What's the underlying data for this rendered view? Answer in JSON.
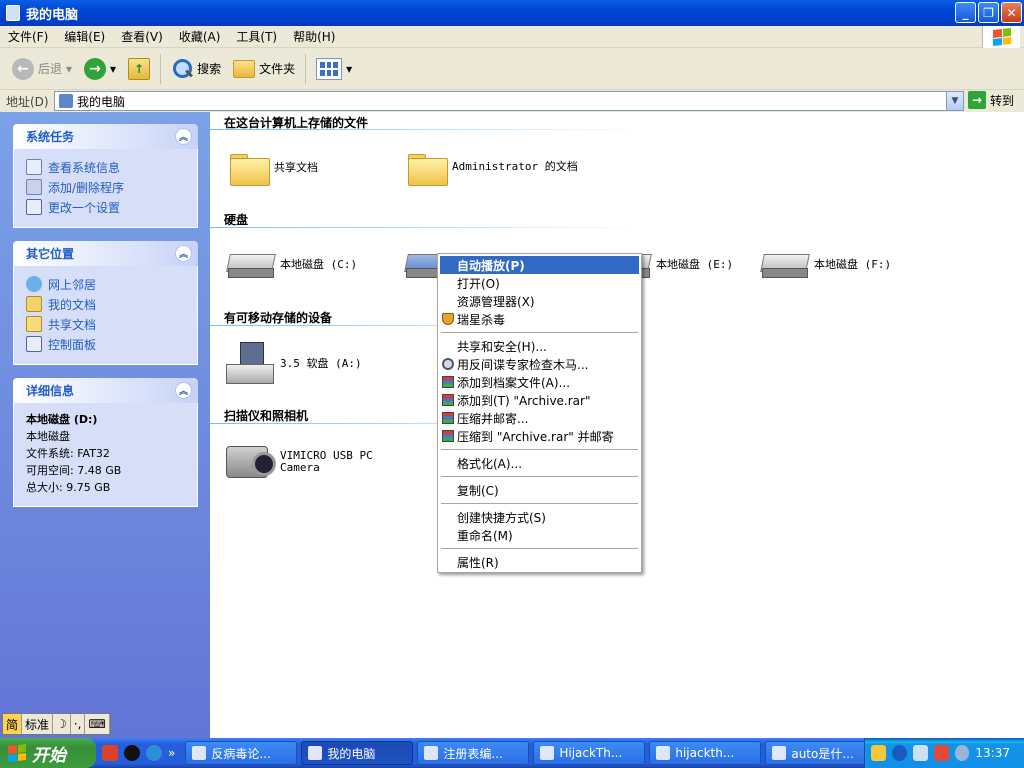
{
  "window": {
    "title": "我的电脑"
  },
  "menubar": [
    "文件(F)",
    "编辑(E)",
    "查看(V)",
    "收藏(A)",
    "工具(T)",
    "帮助(H)"
  ],
  "toolbar": {
    "back": "后退",
    "search": "搜索",
    "folders": "文件夹"
  },
  "address": {
    "label": "地址(D)",
    "value": "我的电脑",
    "go": "转到"
  },
  "sidebar": {
    "system_tasks": {
      "title": "系统任务",
      "items": [
        "查看系统信息",
        "添加/删除程序",
        "更改一个设置"
      ]
    },
    "other_places": {
      "title": "其它位置",
      "items": [
        "网上邻居",
        "我的文档",
        "共享文档",
        "控制面板"
      ]
    },
    "details": {
      "title": "详细信息",
      "name": "本地磁盘  (D:)",
      "type": "本地磁盘",
      "fs": "文件系统: FAT32",
      "free": "可用空间: 7.48 GB",
      "total": "总大小: 9.75 GB"
    }
  },
  "groups": {
    "files": {
      "title": "在这台计算机上存储的文件",
      "items": [
        "共享文档",
        "Administrator 的文档"
      ]
    },
    "hdd": {
      "title": "硬盘",
      "items": [
        "本地磁盘 (C:)",
        "本地磁盘 (E:)",
        "本地磁盘 (F:)"
      ]
    },
    "removable": {
      "title": "有可移动存储的设备",
      "items": [
        "3.5 软盘 (A:)"
      ]
    },
    "scanners": {
      "title": "扫描仪和照相机",
      "items": [
        "VIMICRO USB PC Camera"
      ]
    }
  },
  "context_menu": {
    "items": [
      "自动播放(P)",
      "打开(O)",
      "资源管理器(X)",
      "瑞星杀毒",
      "共享和安全(H)...",
      "用反间谍专家检查木马...",
      "添加到档案文件(A)...",
      "添加到(T) \"Archive.rar\"",
      "压缩并邮寄...",
      "压缩到 \"Archive.rar\" 并邮寄",
      "格式化(A)...",
      "复制(C)",
      "创建快捷方式(S)",
      "重命名(M)",
      "属性(R)"
    ]
  },
  "ime": {
    "mode": "标准"
  },
  "taskbar": {
    "start": "开始",
    "buttons": [
      "反病毒论...",
      "我的电脑",
      "注册表编...",
      "HijackTh...",
      "hijackth...",
      "auto是什..."
    ],
    "clock": "13:37"
  }
}
